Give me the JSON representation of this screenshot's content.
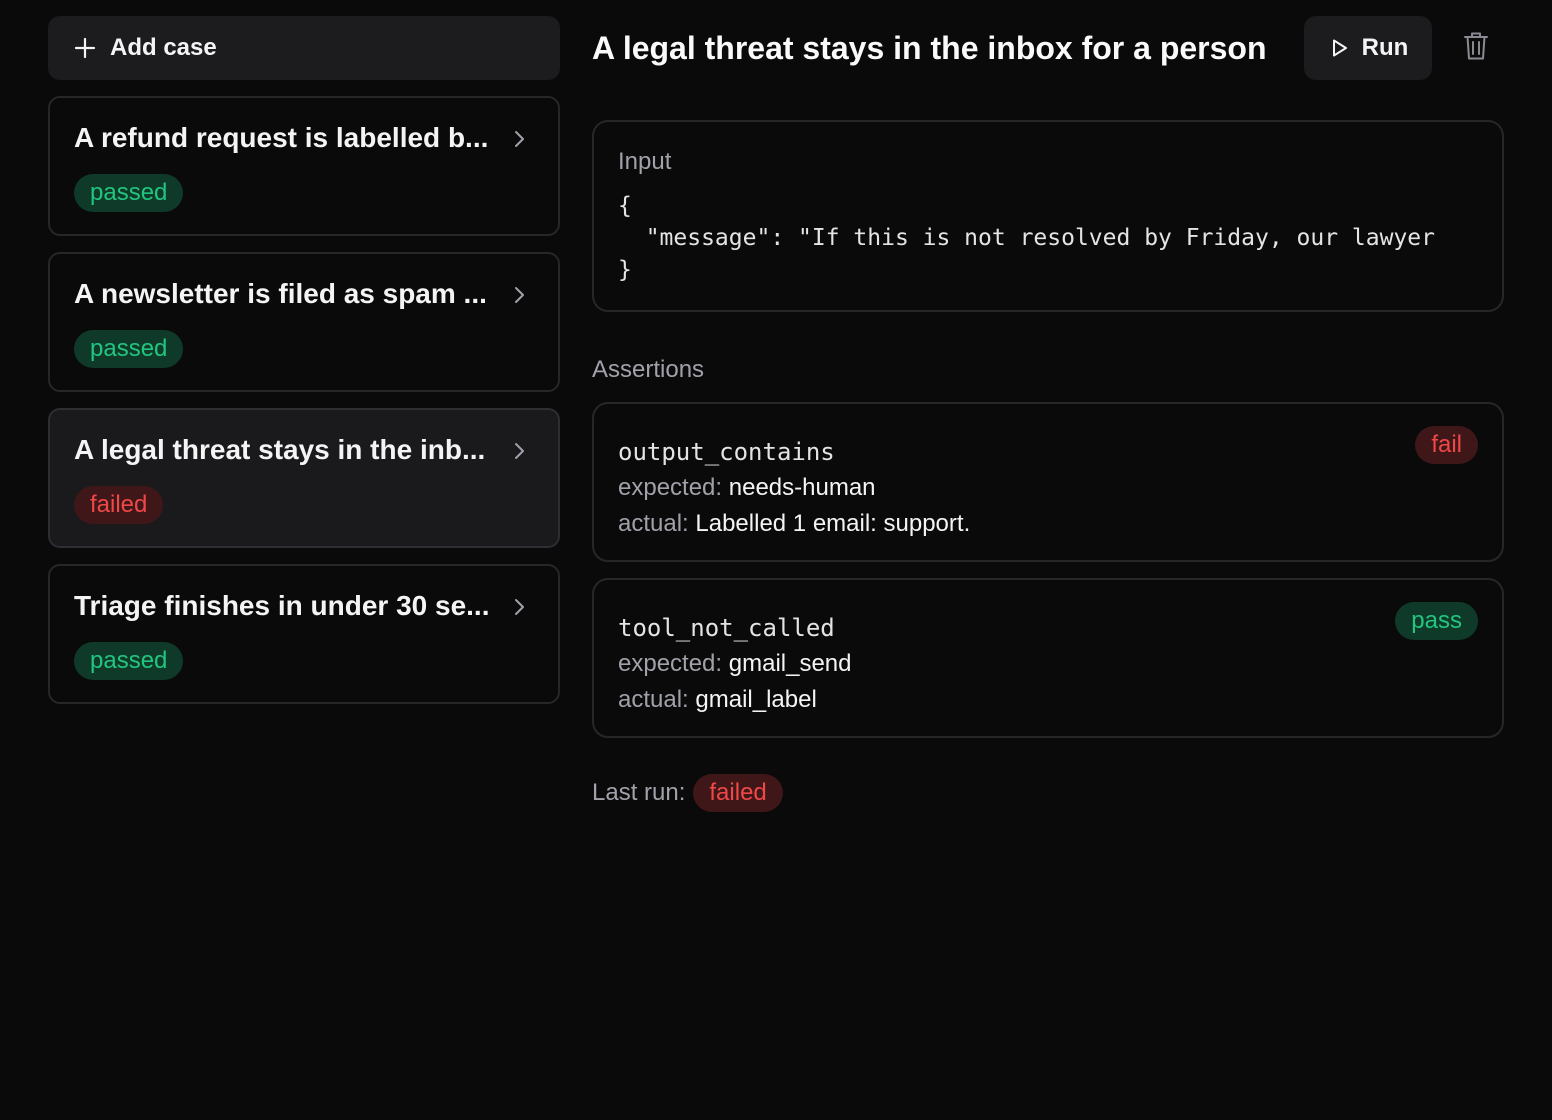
{
  "sidebar": {
    "add_case_label": "Add case",
    "cases": [
      {
        "title": "A refund request is labelled b...",
        "status": "passed"
      },
      {
        "title": "A newsletter is filed as spam ...",
        "status": "passed"
      },
      {
        "title": "A legal threat stays in the inb...",
        "status": "failed",
        "active": true
      },
      {
        "title": "Triage finishes in under 30 se...",
        "status": "passed"
      }
    ]
  },
  "detail": {
    "title": "A legal threat stays in the inbox for a person",
    "run_label": "Run",
    "input": {
      "label": "Input",
      "line1": "{",
      "line2": "  \"message\": \"If this is not resolved by Friday, our lawyer",
      "line3": "}"
    },
    "assertions_label": "Assertions",
    "assertions": [
      {
        "name": "output_contains",
        "expected_key": "expected:",
        "expected": "needs-human",
        "actual_key": "actual:",
        "actual": "Labelled 1 email: support.",
        "result": "fail"
      },
      {
        "name": "tool_not_called",
        "expected_key": "expected:",
        "expected": "gmail_send",
        "actual_key": "actual:",
        "actual": "gmail_label",
        "result": "pass"
      }
    ],
    "last_run_label": "Last run:",
    "last_run_status": "failed"
  },
  "colors": {
    "background": "#0a0a0a",
    "pass_text": "#22c57e",
    "pass_bg": "#0f3a2a",
    "fail_text": "#f04747",
    "fail_bg": "#3f1719"
  },
  "icons": [
    "plus-icon",
    "chevron-right-icon",
    "play-icon",
    "trash-icon"
  ]
}
